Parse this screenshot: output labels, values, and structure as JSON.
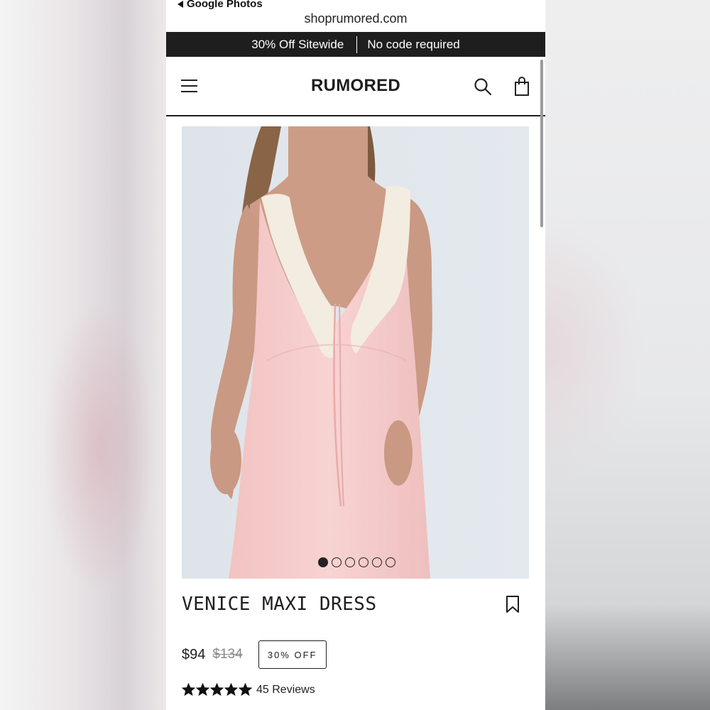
{
  "browser": {
    "back_label": "Google Photos",
    "url": "shoprumored.com"
  },
  "promo_bar": {
    "left_text": "30% Off Sitewide",
    "right_text": "No code required"
  },
  "header": {
    "logo": "RUMORED",
    "icons": [
      "menu-icon",
      "search-icon",
      "shopping-bag-icon"
    ]
  },
  "gallery": {
    "image_count": 6,
    "active_index": 0
  },
  "product": {
    "title": "VENICE MAXI DRESS",
    "price": "$94",
    "original_price": "$134",
    "discount_badge": "30% OFF",
    "rating": 5,
    "reviews_label": "45 Reviews"
  },
  "colors": {
    "promo_bg": "#1e1e1e",
    "dress_pink": "#f3c7c6",
    "lace": "#f3ece0",
    "image_bg": "#dde3e8"
  }
}
